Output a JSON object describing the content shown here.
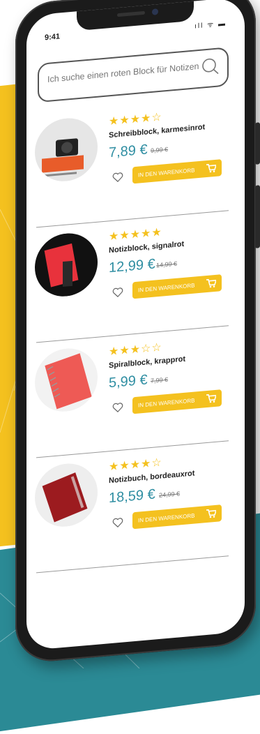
{
  "status": {
    "time": "9:41",
    "icons": "ıll ᯤ ▬"
  },
  "search": {
    "placeholder": "Ich suche einen roten Block für Notizen"
  },
  "colors": {
    "accent_yellow": "#f4c11f",
    "price_teal": "#2f8ea2",
    "bg_teal": "#2b8a95"
  },
  "products": [
    {
      "stars": "★★★★☆",
      "name": "Schreibblock, karmesinrot",
      "price": "7,89 €",
      "old_price": "9,99 €",
      "cart_label": "IN DEN WARENKORB"
    },
    {
      "stars": "★★★★★",
      "name": "Notizblock, signalrot",
      "price": "12,99 €",
      "old_price": "14,99 €",
      "cart_label": "IN DEN WARENKORB"
    },
    {
      "stars": "★★★☆☆",
      "name": "Spiralblock, krapprot",
      "price": "5,99 €",
      "old_price": "7,99 €",
      "cart_label": "IN DEN WARENKORB"
    },
    {
      "stars": "★★★★☆",
      "name": "Notizbuch, bordeauxrot",
      "price": "18,59 €",
      "old_price": "24,99 €",
      "cart_label": "IN DEN WARENKORB"
    }
  ]
}
